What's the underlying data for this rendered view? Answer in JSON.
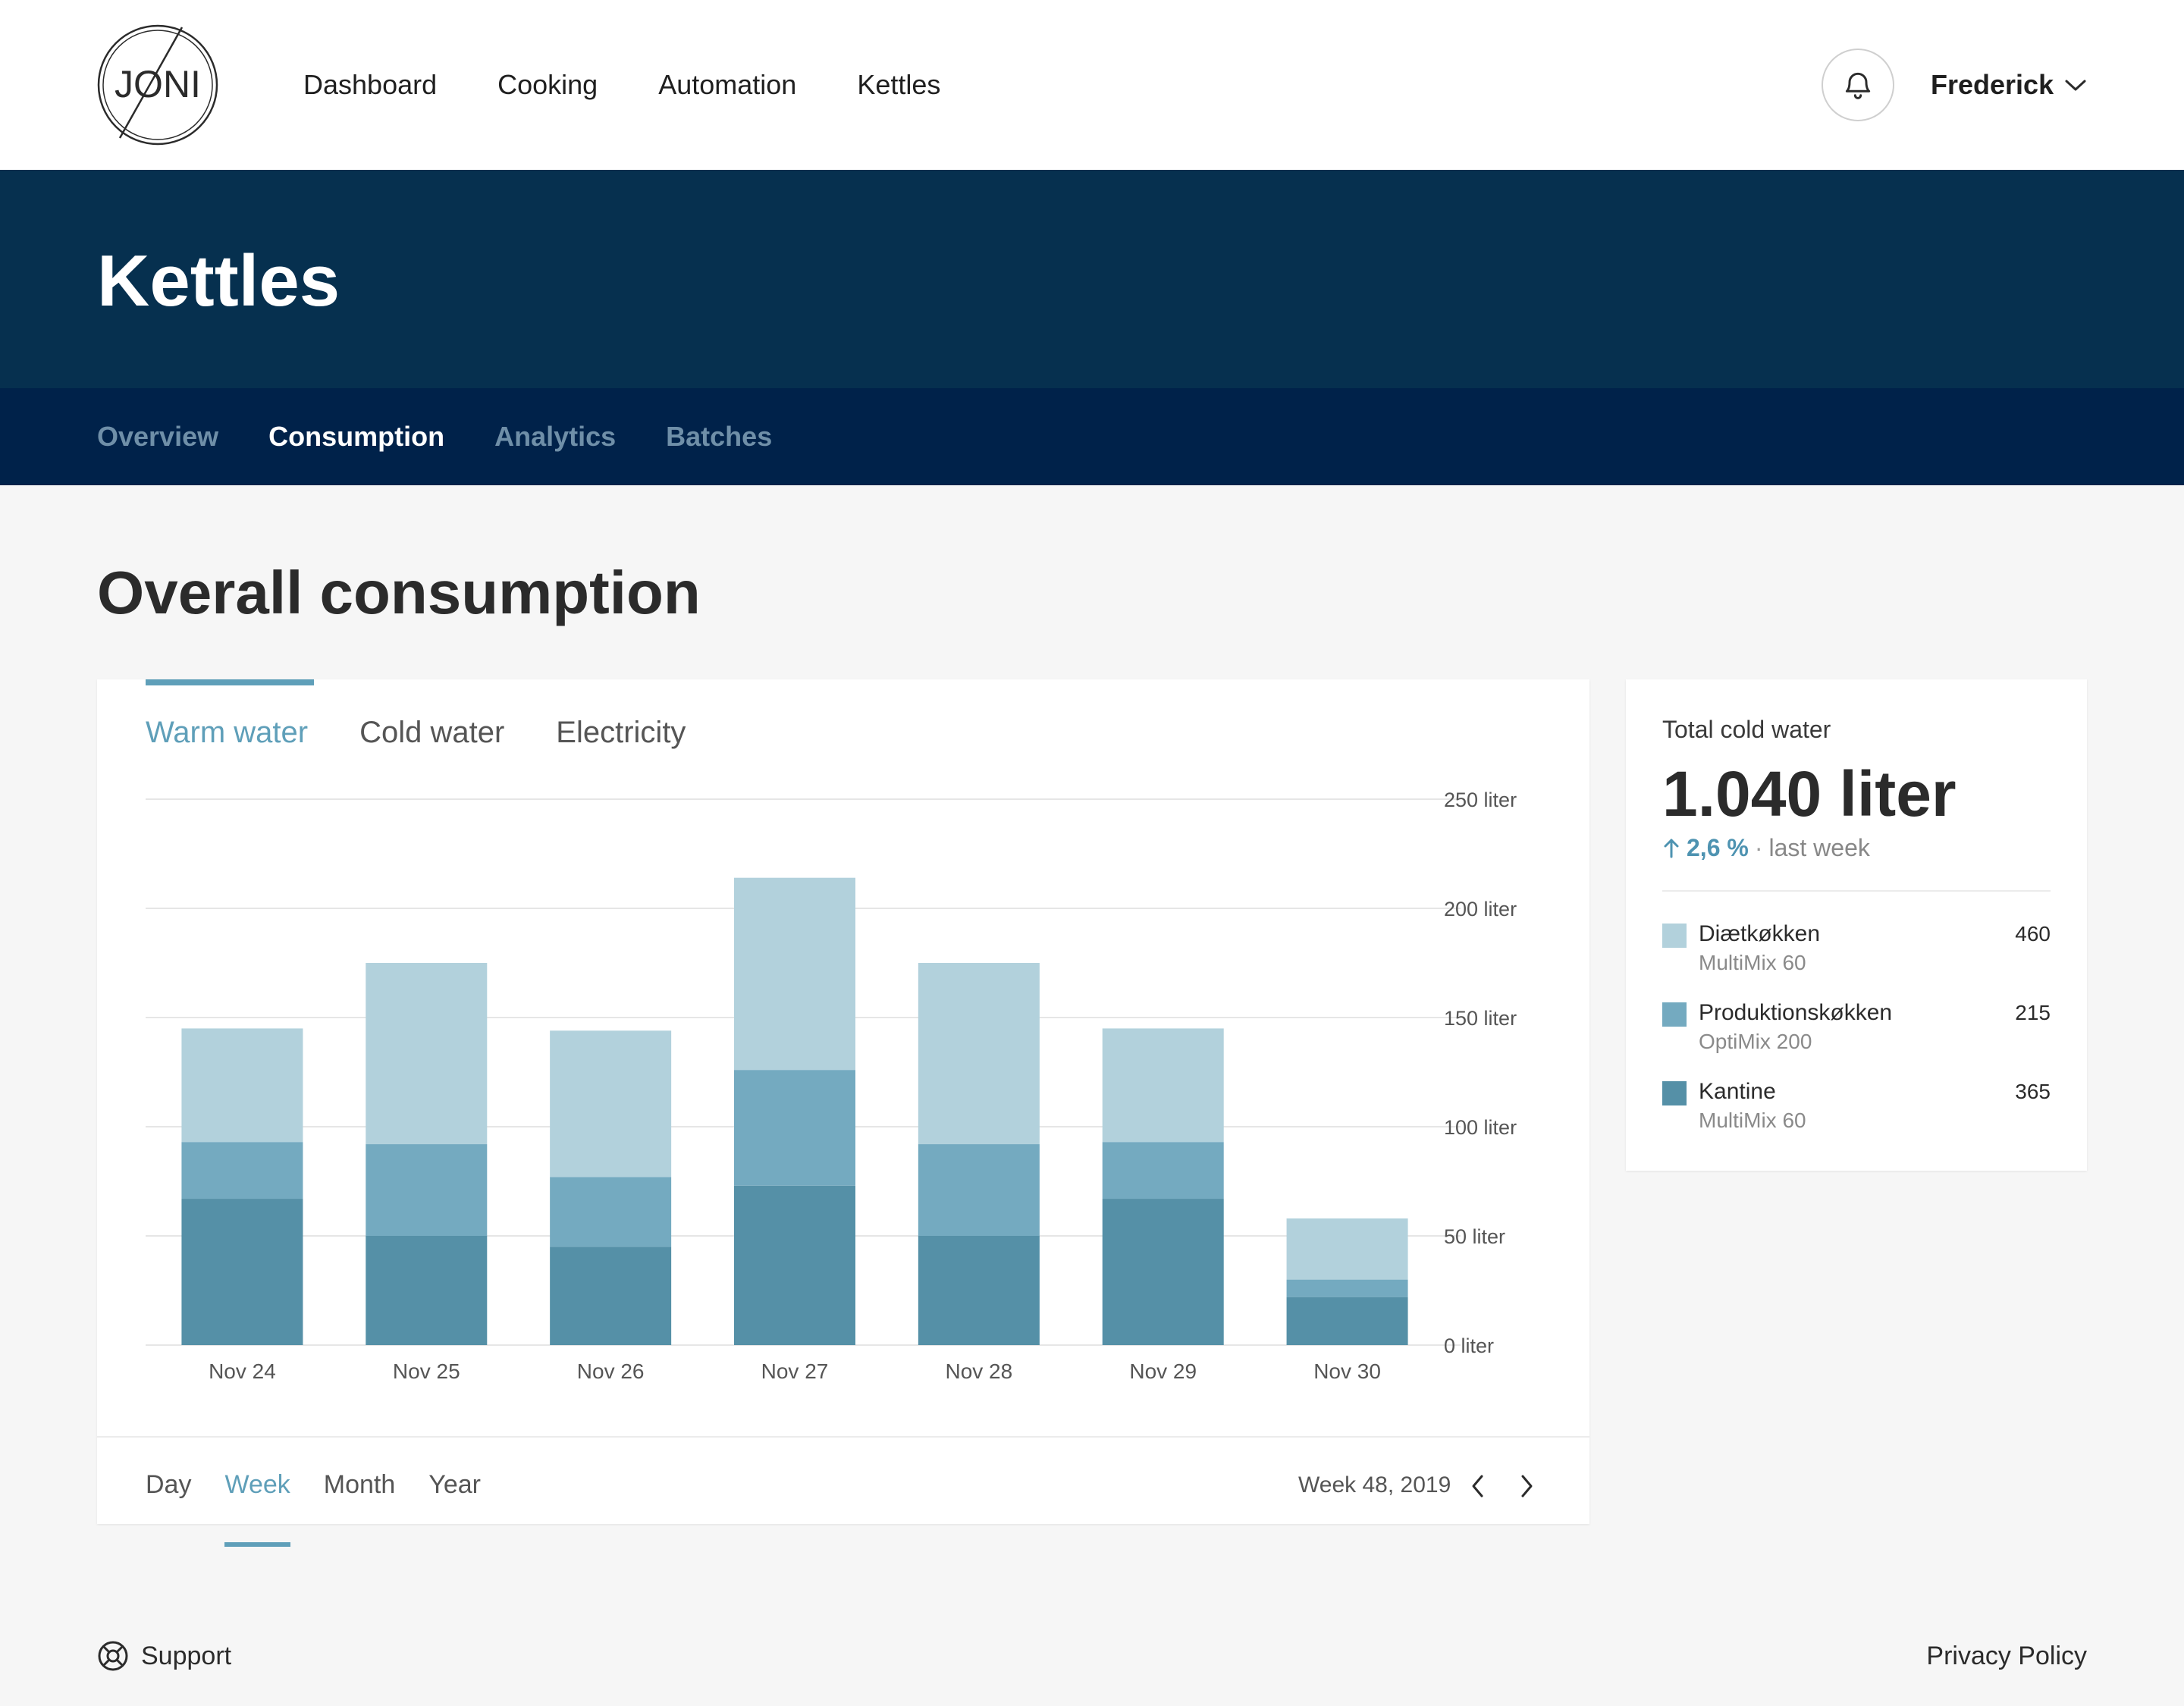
{
  "brand": {
    "logo_text": "JONI"
  },
  "nav": {
    "items": [
      {
        "label": "Dashboard"
      },
      {
        "label": "Cooking"
      },
      {
        "label": "Automation"
      },
      {
        "label": "Kettles"
      }
    ]
  },
  "user": {
    "name": "Frederick"
  },
  "hero": {
    "title": "Kettles"
  },
  "subnav": {
    "items": [
      {
        "label": "Overview"
      },
      {
        "label": "Consumption"
      },
      {
        "label": "Analytics"
      },
      {
        "label": "Batches"
      }
    ],
    "active": "Consumption"
  },
  "section": {
    "title": "Overall consumption"
  },
  "chart_card": {
    "tabs": [
      {
        "label": "Warm water"
      },
      {
        "label": "Cold water"
      },
      {
        "label": "Electricity"
      }
    ],
    "active_tab": "Warm water",
    "period_tabs": [
      {
        "label": "Day"
      },
      {
        "label": "Week"
      },
      {
        "label": "Month"
      },
      {
        "label": "Year"
      }
    ],
    "active_period": "Week",
    "week_label": "Week 48, 2019"
  },
  "chart_data": {
    "type": "bar",
    "stacked": true,
    "categories": [
      "Nov 24",
      "Nov 25",
      "Nov 26",
      "Nov 27",
      "Nov 28",
      "Nov 29",
      "Nov 30"
    ],
    "series": [
      {
        "name": "Kantine",
        "color": "#5590a7",
        "values": [
          67,
          50,
          45,
          73,
          50,
          67,
          22
        ]
      },
      {
        "name": "Produktionskøkken",
        "color": "#74aac0",
        "values": [
          26,
          42,
          32,
          53,
          42,
          26,
          8
        ]
      },
      {
        "name": "Diætkøkken",
        "color": "#b2d1dc",
        "values": [
          52,
          83,
          67,
          88,
          83,
          52,
          28
        ]
      }
    ],
    "y_ticks": [
      "0 liter",
      "50 liter",
      "100 liter",
      "150 liter",
      "200 liter",
      "250 liter"
    ],
    "ylim": [
      0,
      250
    ],
    "grid": true
  },
  "summary": {
    "label": "Total cold water",
    "total": "1.040 liter",
    "change": "2,6 %",
    "separator": "·",
    "change_period": "last week",
    "items": [
      {
        "name": "Diætkøkken",
        "model": "MultiMix 60",
        "value": "460",
        "color": "#b2d1dc"
      },
      {
        "name": "Produktionskøkken",
        "model": "OptiMix 200",
        "value": "215",
        "color": "#74aac0"
      },
      {
        "name": "Kantine",
        "model": "MultiMix 60",
        "value": "365",
        "color": "#5590a7"
      }
    ]
  },
  "footer": {
    "support": "Support",
    "privacy": "Privacy Policy"
  }
}
